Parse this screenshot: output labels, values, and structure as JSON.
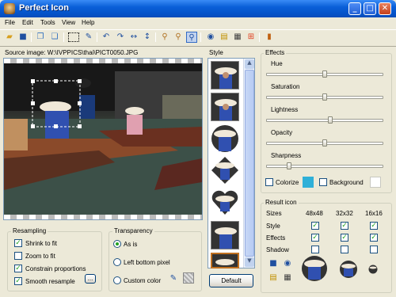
{
  "window": {
    "title": "Perfect Icon"
  },
  "menu": [
    "File",
    "Edit",
    "Tools",
    "View",
    "Help"
  ],
  "source": {
    "label": "Source image: W:\\IVPPICS\\thai\\PICT0050.JPG"
  },
  "style_panel": {
    "label": "Style",
    "default_button": "Default"
  },
  "effects": {
    "label": "Effects",
    "sliders": [
      {
        "name": "Hue",
        "value": 0.5
      },
      {
        "name": "Saturation",
        "value": 0.5
      },
      {
        "name": "Lightness",
        "value": 0.55
      },
      {
        "name": "Opacity",
        "value": 0.5
      },
      {
        "name": "Sharpness",
        "value": 0.18
      }
    ],
    "colorize_label": "Colorize",
    "colorize_checked": false,
    "colorize_color": "#2fb0d8",
    "background_label": "Background",
    "background_checked": false,
    "background_color": "#ffffff"
  },
  "result": {
    "label": "Result icon",
    "sizes_label": "Sizes",
    "sizes": [
      "48x48",
      "32x32",
      "16x16"
    ],
    "rows": [
      {
        "label": "Style",
        "checks": [
          true,
          true,
          true
        ]
      },
      {
        "label": "Effects",
        "checks": [
          true,
          true,
          true
        ]
      },
      {
        "label": "Shadow",
        "checks": [
          false,
          false,
          false
        ]
      }
    ]
  },
  "resampling": {
    "label": "Resampling",
    "options": [
      {
        "label": "Shrink to fit",
        "checked": true
      },
      {
        "label": "Zoom to fit",
        "checked": false
      },
      {
        "label": "Constrain proportions",
        "checked": true
      },
      {
        "label": "Smooth resample",
        "checked": true
      }
    ],
    "more_button": "..."
  },
  "transparency": {
    "label": "Transparency",
    "options": [
      {
        "label": "As is",
        "selected": true
      },
      {
        "label": "Left bottom pixel",
        "selected": false
      },
      {
        "label": "Custom color",
        "selected": false
      }
    ]
  }
}
